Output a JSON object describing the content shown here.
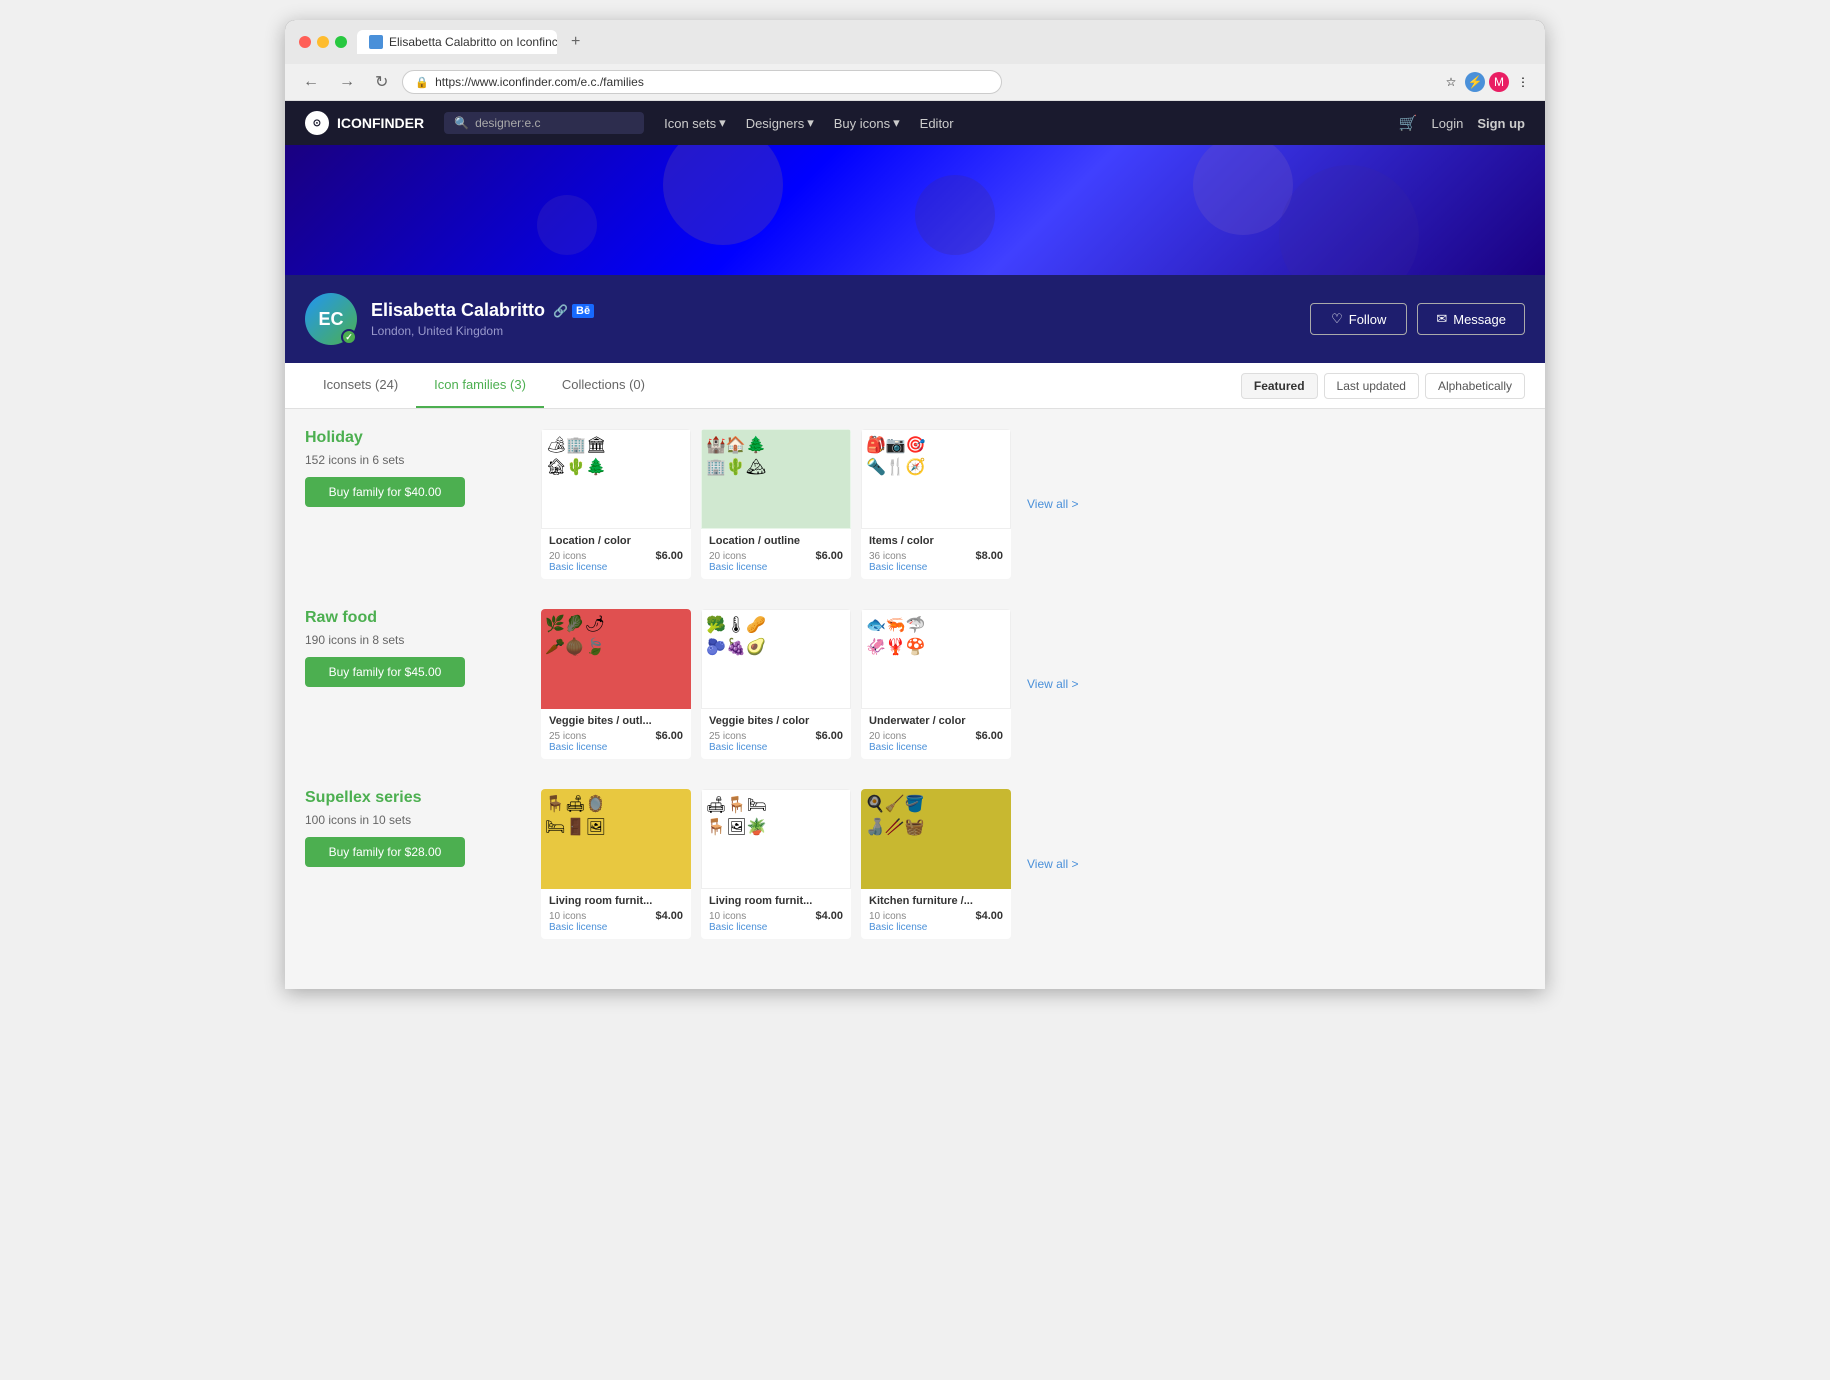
{
  "browser": {
    "url": "https://www.iconfinder.com/e.c./families",
    "tab_title": "Elisabetta Calabritto on Iconfinc...",
    "back_btn": "←",
    "forward_btn": "→",
    "refresh_btn": "↻"
  },
  "nav": {
    "logo": "ICONFINDER",
    "search_placeholder": "designer:e.c",
    "links": [
      "Icon sets",
      "Designers",
      "Buy icons",
      "Editor"
    ],
    "login": "Login",
    "signup": "Sign up"
  },
  "profile": {
    "initials": "EC",
    "name": "Elisabetta Calabritto",
    "location": "London, United Kingdom",
    "follow_label": "Follow",
    "message_label": "Message"
  },
  "tabs": [
    {
      "label": "Iconsets (24)",
      "active": false
    },
    {
      "label": "Icon families (3)",
      "active": true
    },
    {
      "label": "Collections (0)",
      "active": false
    }
  ],
  "sort_options": [
    {
      "label": "Featured",
      "active": true
    },
    {
      "label": "Last updated",
      "active": false
    },
    {
      "label": "Alphabetically",
      "active": false
    }
  ],
  "families": [
    {
      "name": "Holiday",
      "meta": "152 icons in 6 sets",
      "buy_label": "Buy family for $40.00",
      "sets": [
        {
          "name": "Location / color",
          "count": "20 icons",
          "price": "$6.00",
          "license": "Basic license",
          "color": "white",
          "icons": [
            "🏕",
            "🏢",
            "🏛",
            "🏚",
            "🌵",
            "🌲"
          ]
        },
        {
          "name": "Location / outline",
          "count": "20 icons",
          "price": "$6.00",
          "license": "Basic license",
          "color": "green-outline",
          "icons": [
            "🏰",
            "🏠",
            "🌲",
            "🏢",
            "🌵",
            "🏔"
          ]
        },
        {
          "name": "Items / color",
          "count": "36 icons",
          "price": "$8.00",
          "license": "Basic license",
          "color": "white",
          "icons": [
            "🎒",
            "📷",
            "🎯",
            "🔦",
            "🍴",
            "🧭"
          ]
        }
      ],
      "view_all": "View all >"
    },
    {
      "name": "Raw food",
      "meta": "190 icons in 8 sets",
      "buy_label": "Buy family for $45.00",
      "sets": [
        {
          "name": "Veggie bites / outl...",
          "count": "25 icons",
          "price": "$6.00",
          "license": "Basic license",
          "color": "red",
          "icons": [
            "🌿",
            "🥬",
            "🌶",
            "🥕",
            "🧅",
            "🍃"
          ]
        },
        {
          "name": "Veggie bites / color",
          "count": "25 icons",
          "price": "$6.00",
          "license": "Basic license",
          "color": "white",
          "icons": [
            "🥦",
            "🌡",
            "🥜",
            "🫐",
            "🍇",
            "🥑"
          ]
        },
        {
          "name": "Underwater / color",
          "count": "20 icons",
          "price": "$6.00",
          "license": "Basic license",
          "color": "white",
          "icons": [
            "🐟",
            "🦐",
            "🦈",
            "🦑",
            "🦞",
            "🍄"
          ]
        }
      ],
      "view_all": "View all >"
    },
    {
      "name": "Supellex series",
      "meta": "100 icons in 10 sets",
      "buy_label": "Buy family for $28.00",
      "sets": [
        {
          "name": "Living room furnit...",
          "count": "10 icons",
          "price": "$4.00",
          "license": "Basic license",
          "color": "yellow",
          "icons": [
            "🪑",
            "🛋",
            "🪞",
            "🛏",
            "🚪",
            "🖼"
          ]
        },
        {
          "name": "Living room furnit...",
          "count": "10 icons",
          "price": "$4.00",
          "license": "Basic license",
          "color": "white",
          "icons": [
            "🛋",
            "🪑",
            "🛏",
            "🪑",
            "🖼",
            "🪴"
          ]
        },
        {
          "name": "Kitchen furniture /...",
          "count": "10 icons",
          "price": "$4.00",
          "license": "Basic license",
          "color": "olive",
          "icons": [
            "🍳",
            "🧹",
            "🪣",
            "🍶",
            "🥢",
            "🧺"
          ]
        }
      ],
      "view_all": "View all >"
    }
  ]
}
